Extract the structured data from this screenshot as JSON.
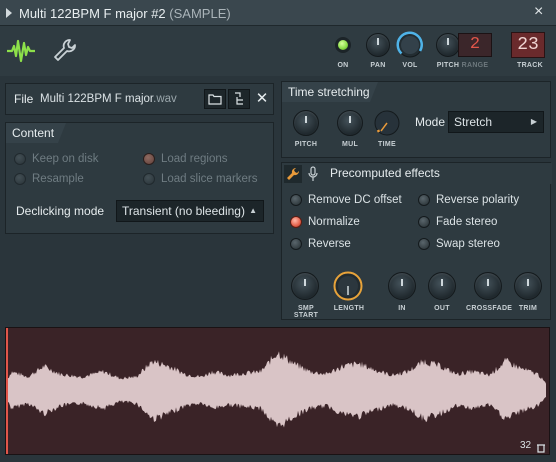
{
  "window": {
    "title": "Multi 122BPM F major #2",
    "subtitle": "(SAMPLE)",
    "close": "×"
  },
  "toolbar": {
    "controls": {
      "on": "ON",
      "pan": "PAN",
      "vol": "VOL",
      "pitch": "PITCH",
      "range": "RANGE",
      "track": "TRACK"
    },
    "range_value": "2",
    "track_value": "23",
    "colors": {
      "led_on": "#8de04a",
      "vol_ring": "#4fb3e8",
      "track": "#e0564a"
    }
  },
  "file": {
    "label": "File",
    "name": "Multi 122BPM F major",
    "ext": ".wav"
  },
  "content": {
    "title": "Content",
    "options": [
      {
        "label": "Keep on disk",
        "state": "off"
      },
      {
        "label": "Load regions",
        "state": "on"
      },
      {
        "label": "Resample",
        "state": "off"
      },
      {
        "label": "Load slice markers",
        "state": "off"
      }
    ],
    "declicking_label": "Declicking mode",
    "declicking_value": "Transient (no bleeding)"
  },
  "time_stretching": {
    "title": "Time stretching",
    "knobs": {
      "pitch": "PITCH",
      "mul": "MUL",
      "time": "TIME"
    },
    "mode_label": "Mode",
    "mode_value": "Stretch"
  },
  "precomputed": {
    "title": "Precomputed effects",
    "effects_left": [
      {
        "label": "Remove DC offset",
        "on": false
      },
      {
        "label": "Normalize",
        "on": true
      },
      {
        "label": "Reverse",
        "on": false
      }
    ],
    "effects_right": [
      {
        "label": "Reverse polarity",
        "on": false
      },
      {
        "label": "Fade stereo",
        "on": false
      },
      {
        "label": "Swap stereo",
        "on": false
      }
    ],
    "knobs": {
      "smp_start": "SMP START",
      "length": "LENGTH",
      "in": "IN",
      "out": "OUT",
      "crossfade": "CROSSFADE",
      "trim": "TRIM"
    }
  },
  "waveform": {
    "zoom": "32",
    "color": "#d9c4c6"
  }
}
